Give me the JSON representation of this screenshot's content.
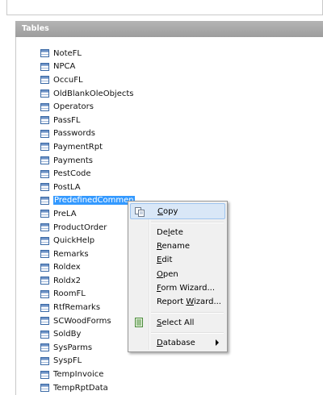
{
  "panel": {
    "title": "Tables"
  },
  "tables": [
    "NoteFL",
    "NPCA",
    "OccuFL",
    "OldBlankOleObjects",
    "Operators",
    "PassFL",
    "Passwords",
    "PaymentRpt",
    "Payments",
    "PestCode",
    "PostLA",
    "PredefinedCommen",
    "PreLA",
    "ProductOrder",
    "QuickHelp",
    "Remarks",
    "Roldex",
    "Roldx2",
    "RoomFL",
    "RtfRemarks",
    "SCWoodForms",
    "SoldBy",
    "SysParms",
    "SyspFL",
    "TempInvoice",
    "TempRptData"
  ],
  "selected_table": "PredefinedCommen",
  "context_menu": {
    "items": [
      {
        "pre": "",
        "key": "C",
        "post": "opy",
        "icon": "copy-icon",
        "hover": true
      },
      {
        "pre": "De",
        "key": "l",
        "post": "ete"
      },
      {
        "pre": "",
        "key": "R",
        "post": "ename"
      },
      {
        "pre": "",
        "key": "E",
        "post": "dit"
      },
      {
        "pre": "",
        "key": "O",
        "post": "pen"
      },
      {
        "pre": "",
        "key": "F",
        "post": "orm Wizard..."
      },
      {
        "pre": "Report ",
        "key": "W",
        "post": "izard..."
      },
      {
        "pre": "",
        "key": "S",
        "post": "elect All",
        "icon": "select-all-icon"
      },
      {
        "pre": "",
        "key": "D",
        "post": "atabase",
        "submenu": true
      }
    ]
  }
}
